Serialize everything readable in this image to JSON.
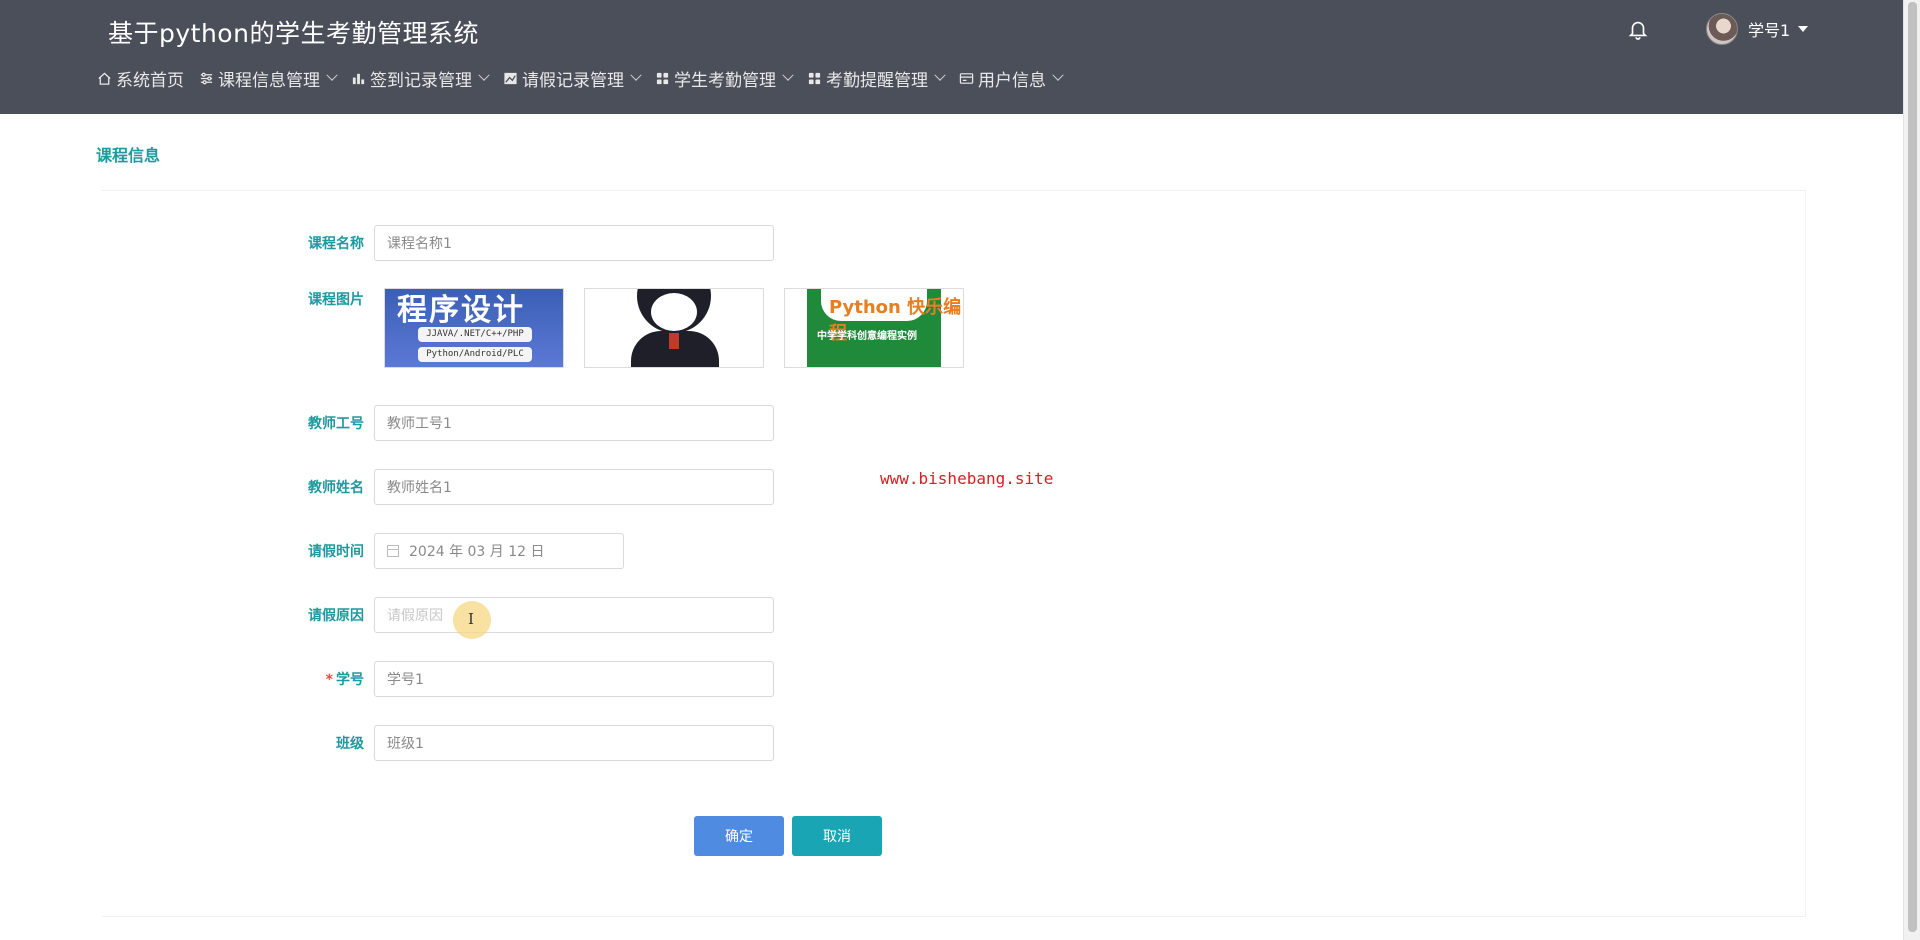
{
  "header": {
    "app_title": "基于python的学生考勤管理系统",
    "user_name": "学号1"
  },
  "nav": {
    "items": [
      {
        "label": "系统首页",
        "icon": "home-icon",
        "has_dropdown": false
      },
      {
        "label": "课程信息管理",
        "icon": "sliders-icon",
        "has_dropdown": true
      },
      {
        "label": "签到记录管理",
        "icon": "bar-chart-icon",
        "has_dropdown": true
      },
      {
        "label": "请假记录管理",
        "icon": "chart-image-icon",
        "has_dropdown": true
      },
      {
        "label": "学生考勤管理",
        "icon": "grid-icon",
        "has_dropdown": true
      },
      {
        "label": "考勤提醒管理",
        "icon": "grid-icon",
        "has_dropdown": true
      },
      {
        "label": "用户信息",
        "icon": "card-icon",
        "has_dropdown": true
      }
    ]
  },
  "section_title": "课程信息",
  "form": {
    "course_name": {
      "label": "课程名称",
      "value": "课程名称1"
    },
    "course_image": {
      "label": "课程图片",
      "thumb1": {
        "big": "程序设计",
        "line1": "JJAVA/.NET/C++/PHP",
        "line2": "Python/Android/PLC"
      },
      "thumb3": {
        "title": "Python 快乐编程",
        "sub": "中学学科创意编程实例"
      }
    },
    "teacher_id": {
      "label": "教师工号",
      "value": "教师工号1"
    },
    "teacher_name": {
      "label": "教师姓名",
      "value": "教师姓名1"
    },
    "leave_time": {
      "label": "请假时间",
      "value": "2024 年 03 月 12 日"
    },
    "leave_reason": {
      "label": "请假原因",
      "placeholder": "请假原因"
    },
    "student_id": {
      "label": "学号",
      "required_mark": "*",
      "value": "学号1"
    },
    "class": {
      "label": "班级",
      "value": "班级1"
    }
  },
  "watermark": "www.bishebang.site",
  "buttons": {
    "confirm": "确定",
    "cancel": "取消"
  },
  "colors": {
    "topbar": "#4a4f5a",
    "accent": "#1d9aa0",
    "primary_button": "#4f8be0",
    "cancel_button": "#19a5b4"
  }
}
